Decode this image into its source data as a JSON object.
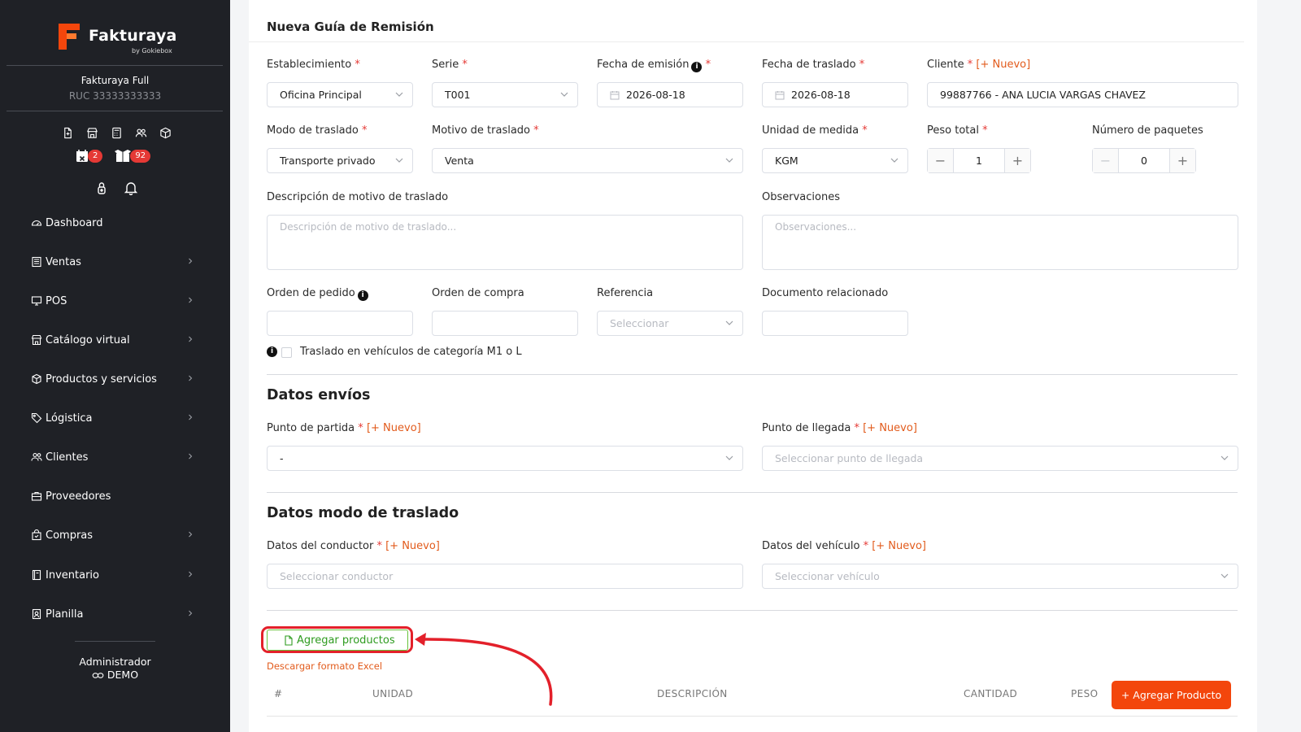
{
  "sidebar": {
    "logo_text": "Fakturaya",
    "logo_sub": "by Gokiebox",
    "company": "Fakturaya Full",
    "ruc": "RUC 33333333333",
    "quick_icons": [
      "document-icon",
      "store-icon",
      "calculator-icon",
      "users-icon",
      "box-icon"
    ],
    "badge_calendar": "2",
    "badge_box": "92",
    "menu": [
      {
        "label": "Dashboard",
        "icon": "gauge-icon",
        "has_children": false
      },
      {
        "label": "Ventas",
        "icon": "receipt-icon",
        "has_children": true
      },
      {
        "label": "POS",
        "icon": "monitor-icon",
        "has_children": true
      },
      {
        "label": "Catálogo virtual",
        "icon": "store-icon",
        "has_children": true
      },
      {
        "label": "Productos y servicios",
        "icon": "box-icon",
        "has_children": true
      },
      {
        "label": "Lógistica",
        "icon": "tag-icon",
        "has_children": true
      },
      {
        "label": "Clientes",
        "icon": "users-icon",
        "has_children": true
      },
      {
        "label": "Proveedores",
        "icon": "briefcase-icon",
        "has_children": false
      },
      {
        "label": "Compras",
        "icon": "shopping-bag-icon",
        "has_children": true
      },
      {
        "label": "Inventario",
        "icon": "book-icon",
        "has_children": true
      },
      {
        "label": "Planilla",
        "icon": "id-card-icon",
        "has_children": true
      }
    ],
    "admin_label": "Administrador",
    "demo_label": "DEMO"
  },
  "form": {
    "title": "Nueva Guía de Remisión",
    "establecimiento": {
      "label": "Establecimiento",
      "value": "Oficina Principal"
    },
    "serie": {
      "label": "Serie",
      "value": "T001"
    },
    "fecha_emision": {
      "label": "Fecha de emisión",
      "value": "2026-08-18"
    },
    "fecha_traslado": {
      "label": "Fecha de traslado",
      "value": "2026-08-18"
    },
    "cliente": {
      "label": "Cliente",
      "new_link": "[+ Nuevo]",
      "value": "99887766 - ANA LUCIA VARGAS CHAVEZ"
    },
    "modo_traslado": {
      "label": "Modo de traslado",
      "value": "Transporte privado"
    },
    "motivo_traslado": {
      "label": "Motivo de traslado",
      "value": "Venta"
    },
    "unidad_medida": {
      "label": "Unidad de medida",
      "value": "KGM"
    },
    "peso_total": {
      "label": "Peso total",
      "value": "1"
    },
    "numero_paquetes": {
      "label": "Número de paquetes",
      "value": "0"
    },
    "descripcion_motivo": {
      "label": "Descripción de motivo de traslado",
      "placeholder": "Descripción de motivo de traslado..."
    },
    "observaciones": {
      "label": "Observaciones",
      "placeholder": "Observaciones..."
    },
    "orden_pedido": {
      "label": "Orden de pedido",
      "value": ""
    },
    "orden_compra": {
      "label": "Orden de compra",
      "value": ""
    },
    "referencia": {
      "label": "Referencia",
      "placeholder": "Seleccionar"
    },
    "documento_relacionado": {
      "label": "Documento relacionado",
      "value": ""
    },
    "m1_checkbox_label": "Traslado en vehículos de categoría M1 o L"
  },
  "envios": {
    "title": "Datos envíos",
    "punto_partida": {
      "label": "Punto de partida",
      "new_link": "[+ Nuevo]",
      "value": "-"
    },
    "punto_llegada": {
      "label": "Punto de llegada",
      "new_link": "[+ Nuevo]",
      "placeholder": "Seleccionar punto de llegada"
    }
  },
  "modo": {
    "title": "Datos modo de traslado",
    "conductor": {
      "label": "Datos del conductor",
      "new_link": "[+ Nuevo]",
      "placeholder": "Seleccionar conductor"
    },
    "vehiculo": {
      "label": "Datos del vehículo",
      "new_link": "[+ Nuevo]",
      "placeholder": "Seleccionar vehículo"
    }
  },
  "products": {
    "add_products_label": "Agregar productos",
    "excel_link": "Descargar formato Excel",
    "columns": [
      "#",
      "UNIDAD",
      "DESCRIPCIÓN",
      "CANTIDAD",
      "PESO"
    ],
    "add_product_button": "+ Agregar Producto"
  },
  "colors": {
    "sidebar_bg": "#1f2126",
    "accent_orange": "#f3460c",
    "link_orange": "#e25b1c",
    "required_red": "#e53935",
    "annotation_red": "#e3202a",
    "success_green": "#67c23a"
  }
}
